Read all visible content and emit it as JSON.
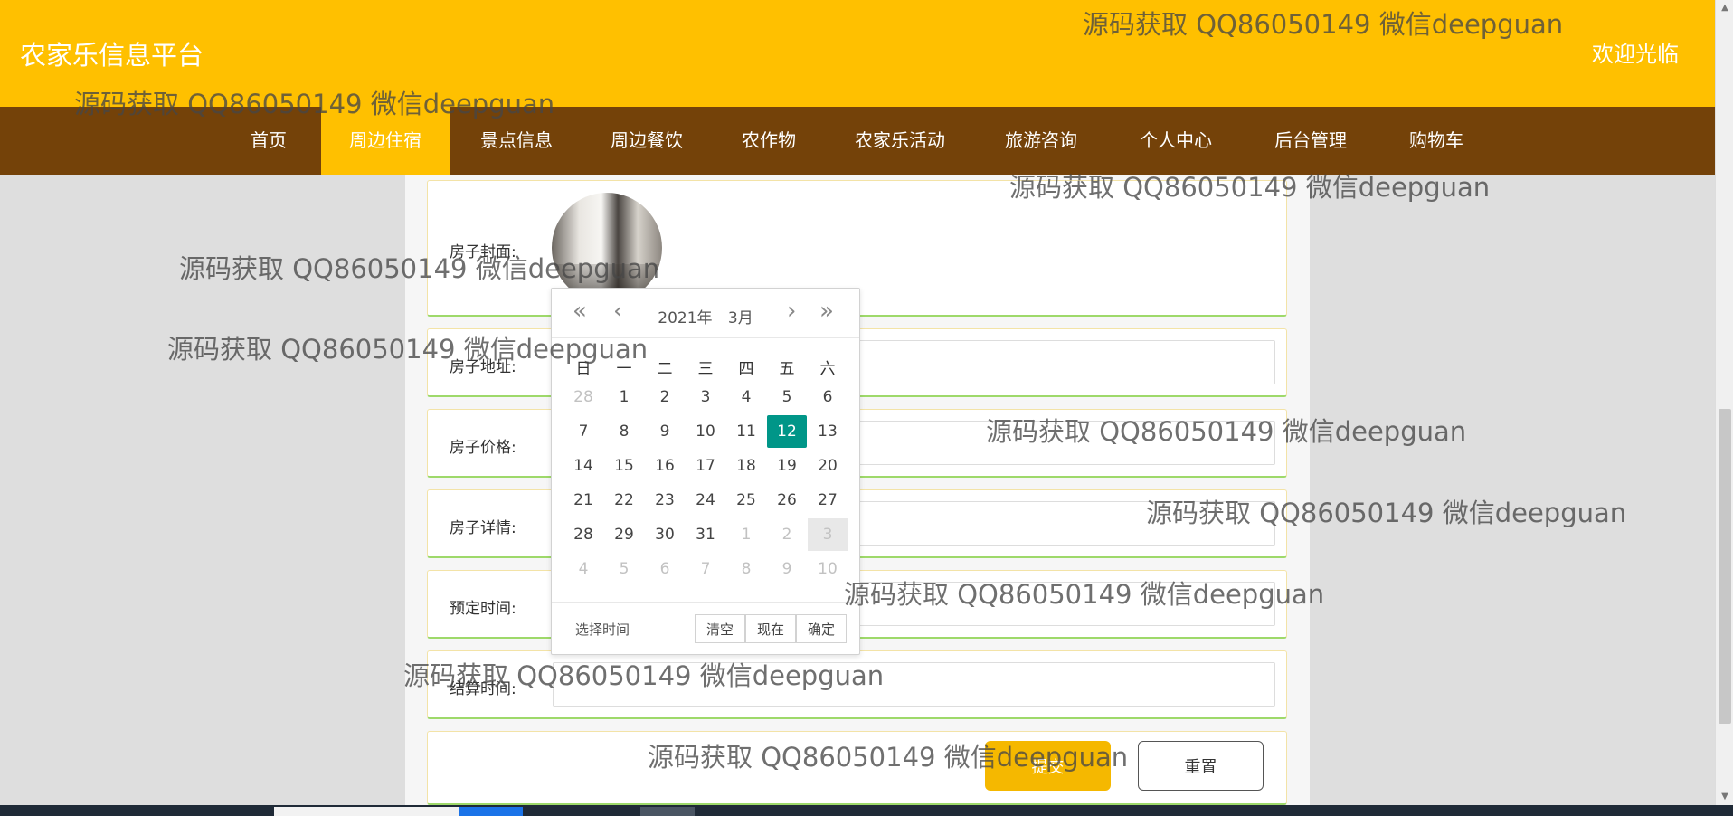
{
  "header": {
    "title": "农家乐信息平台",
    "welcome": "欢迎光临"
  },
  "nav": {
    "items": [
      "首页",
      "周边住宿",
      "景点信息",
      "周边餐饮",
      "农作物",
      "农家乐活动",
      "旅游咨询",
      "个人中心",
      "后台管理",
      "购物车"
    ],
    "active_index": 1
  },
  "form": {
    "cover_label": "房子封面:",
    "address_label": "房子地址:",
    "price_label": "房子价格:",
    "detail_label": "房子详情:",
    "booking_label": "预定时间:",
    "checkout_label": "结算时间:",
    "submit_label": "提交",
    "reset_label": "重置"
  },
  "datepicker": {
    "year": "2021年",
    "month": "3月",
    "prev_year": "«",
    "prev_month": "‹",
    "next_month": "›",
    "next_year": "»",
    "weekdays": [
      "日",
      "一",
      "二",
      "三",
      "四",
      "五",
      "六"
    ],
    "weeks": [
      [
        "28",
        "1",
        "2",
        "3",
        "4",
        "5",
        "6"
      ],
      [
        "7",
        "8",
        "9",
        "10",
        "11",
        "12",
        "13"
      ],
      [
        "14",
        "15",
        "16",
        "17",
        "18",
        "19",
        "20"
      ],
      [
        "21",
        "22",
        "23",
        "24",
        "25",
        "26",
        "27"
      ],
      [
        "28",
        "29",
        "30",
        "31",
        "1",
        "2",
        "3"
      ],
      [
        "4",
        "5",
        "6",
        "7",
        "8",
        "9",
        "10"
      ]
    ],
    "selected_day": "12",
    "footer_label": "选择时间",
    "clear_label": "清空",
    "now_label": "现在",
    "confirm_label": "确定"
  },
  "watermark": "源码获取 QQ86050149 微信deepguan",
  "colors": {
    "header_bg": "#FFC000",
    "nav_bg": "#744209",
    "selected_day": "#009688",
    "submit_bg": "#F5B800"
  }
}
